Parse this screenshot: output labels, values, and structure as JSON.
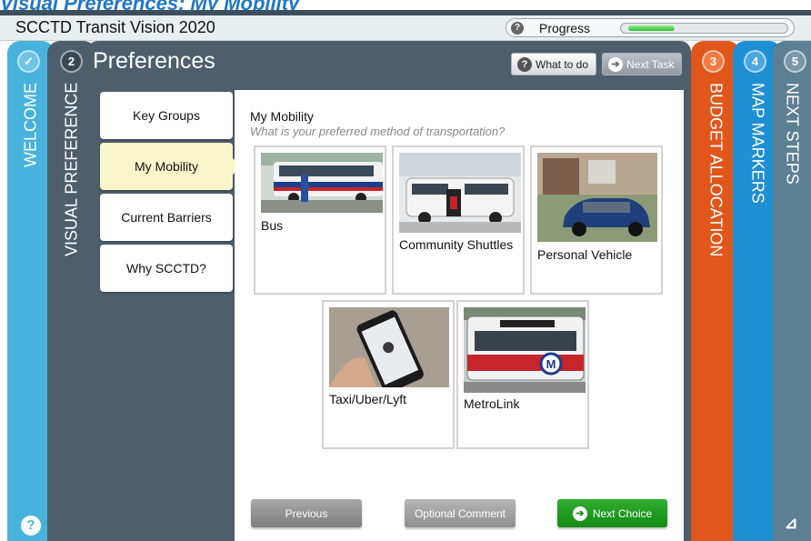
{
  "page_heading": "Visual Preferences: My Mobility",
  "app": {
    "title": "SCCTD Transit Vision 2020",
    "progress_label": "Progress",
    "progress_fraction": 0.3
  },
  "tabs": {
    "welcome": {
      "label": "WELCOME",
      "icon": "check-icon"
    },
    "visual": {
      "number": "2",
      "label": "VISUAL PREFERENCE"
    },
    "budget": {
      "number": "3",
      "label": "BUDGET ALLOCATION"
    },
    "map": {
      "number": "4",
      "label": "MAP MARKERS"
    },
    "next": {
      "number": "5",
      "label": "NEXT STEPS"
    }
  },
  "header": {
    "title": "Preferences",
    "what_to_do": "What to do",
    "next_task": "Next Task"
  },
  "menu": [
    {
      "label": "Key Groups",
      "active": false
    },
    {
      "label": "My Mobility",
      "active": true
    },
    {
      "label": "Current Barriers",
      "active": false
    },
    {
      "label": "Why SCCTD?",
      "active": false
    }
  ],
  "content": {
    "title": "My Mobility",
    "question": "What is your preferred method of transportation?",
    "choices": [
      {
        "label": "Bus"
      },
      {
        "label": "Community Shuttles"
      },
      {
        "label": "Personal Vehicle"
      },
      {
        "label": "Taxi/Uber/Lyft"
      },
      {
        "label": "MetroLink"
      }
    ]
  },
  "footer": {
    "previous": "Previous",
    "optional_comment": "Optional Comment",
    "next_choice": "Next Choice"
  },
  "colors": {
    "welcome": "#47b3dc",
    "visual": "#4f5e6b",
    "budget": "#e0561b",
    "map": "#1f8fd3",
    "next": "#5d7f94",
    "active_menu": "#faf6cc",
    "next_choice": "#1a9a1a"
  }
}
